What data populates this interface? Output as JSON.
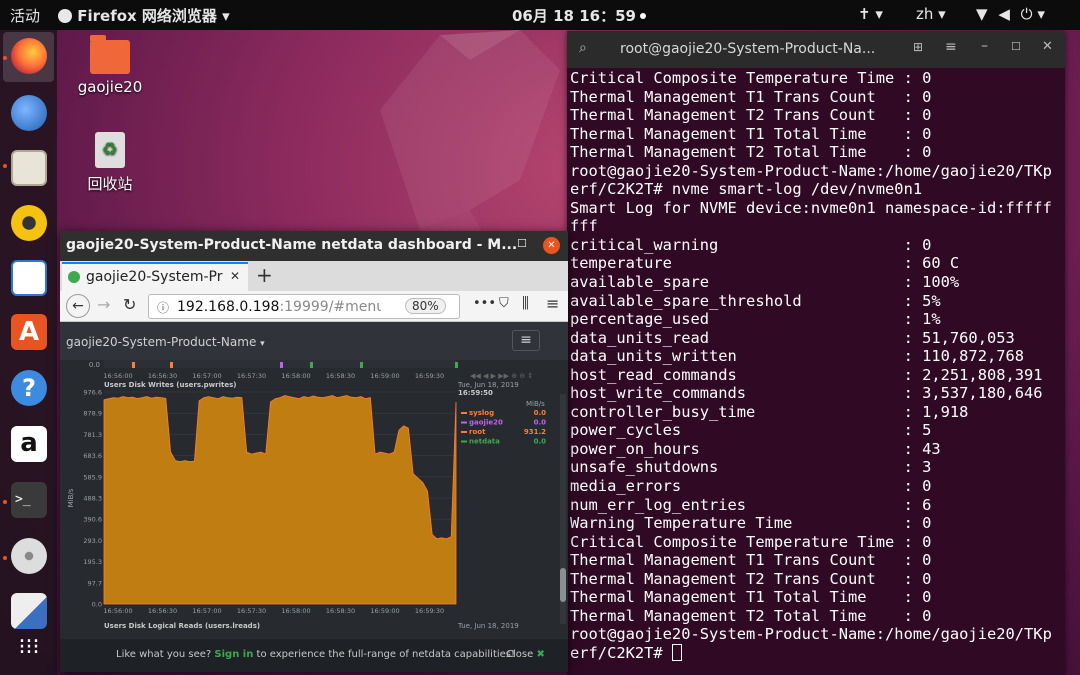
{
  "topbar": {
    "activities": "活动",
    "app": "Firefox 网络浏览器",
    "clock": "06月 18  16：59",
    "lang": "zh"
  },
  "desktop": {
    "icons": [
      {
        "label": "gaojie20"
      },
      {
        "label": "回收站"
      }
    ]
  },
  "dock": {
    "apps": [
      "firefox",
      "thunderbird",
      "files",
      "rhythmbox",
      "writer",
      "software",
      "help",
      "amazon",
      "terminal",
      "disks",
      "text-editor",
      "show-apps"
    ]
  },
  "terminal": {
    "title": "root@gaojie20-System-Product-Na...",
    "lines": [
      "Critical Composite Temperature Time : 0",
      "Thermal Management T1 Trans Count   : 0",
      "Thermal Management T2 Trans Count   : 0",
      "Thermal Management T1 Total Time    : 0",
      "Thermal Management T2 Total Time    : 0",
      "root@gaojie20-System-Product-Name:/home/gaojie20/TKp",
      "erf/C2K2T# nvme smart-log /dev/nvme0n1",
      "Smart Log for NVME device:nvme0n1 namespace-id:fffff",
      "fff",
      "critical_warning                    : 0",
      "temperature                         : 60 C",
      "available_spare                     : 100%",
      "available_spare_threshold           : 5%",
      "percentage_used                     : 1%",
      "data_units_read                     : 51,760,053",
      "data_units_written                  : 110,872,768",
      "host_read_commands                  : 2,251,808,391",
      "host_write_commands                 : 3,537,180,646",
      "controller_busy_time                : 1,918",
      "power_cycles                        : 5",
      "power_on_hours                      : 43",
      "unsafe_shutdowns                    : 3",
      "media_errors                        : 0",
      "num_err_log_entries                 : 6",
      "Warning Temperature Time            : 0",
      "Critical Composite Temperature Time : 0",
      "Thermal Management T1 Trans Count   : 0",
      "Thermal Management T2 Trans Count   : 0",
      "Thermal Management T1 Total Time    : 0",
      "Thermal Management T2 Total Time    : 0",
      "root@gaojie20-System-Product-Name:/home/gaojie20/TKp",
      "erf/C2K2T# "
    ]
  },
  "firefox": {
    "window_title": "gaojie20-System-Product-Name netdata dashboard - M...",
    "tab_title": "gaojie20-System-Pr",
    "url_host": "192.168.0.198",
    "url_rest": ":19999/#menu_",
    "zoom": "80%",
    "site_title": "gaojie20-System-Product-Name",
    "promo_text": "Like what you see?",
    "promo_link": "Sign in",
    "promo_rest": "to experience the full-range of netdata capabilities!",
    "close_label": "Close"
  },
  "chart_data": {
    "type": "area",
    "title": "Users Disk Writes (users.pwrites)",
    "ylabel": "MiB/s",
    "units": "MiB/s",
    "ylim": [
      0,
      976
    ],
    "yticks": [
      "976.6",
      "878.9",
      "781.3",
      "683.6",
      "585.9",
      "488.3",
      "390.6",
      "293.0",
      "195.3",
      "97.7",
      "0.0"
    ],
    "xticks": [
      "16:56:00",
      "16:56:30",
      "16:57:00",
      "16:57:30",
      "16:58:00",
      "16:58:30",
      "16:59:00",
      "16:59:30"
    ],
    "date": "Tue, Jun 18, 2019",
    "time": "16:59:50",
    "series": [
      {
        "name": "syslog",
        "value": "0.0",
        "color": "#fe7d37"
      },
      {
        "name": "gaojie20",
        "value": "0.0",
        "color": "#c061f0"
      },
      {
        "name": "root",
        "value": "931.2",
        "color": "#fe7d37"
      },
      {
        "name": "netdata",
        "value": "0.0",
        "color": "#3ea94d"
      }
    ],
    "root_values": [
      940,
      945,
      950,
      948,
      955,
      950,
      952,
      946,
      950,
      955,
      948,
      952,
      950,
      947,
      700,
      660,
      655,
      660,
      655,
      658,
      935,
      950,
      955,
      950,
      945,
      955,
      950,
      948,
      952,
      950,
      700,
      690,
      695,
      700,
      690,
      930,
      945,
      950,
      960,
      955,
      950,
      945,
      955,
      950,
      958,
      952,
      950,
      955,
      960,
      950,
      955,
      960,
      952,
      950,
      955,
      945,
      950,
      690,
      700,
      695,
      690,
      700,
      800,
      820,
      810,
      600,
      580,
      560,
      520,
      320,
      300,
      305,
      300,
      310,
      930
    ],
    "next_title": "Users Disk Logical Reads (users.lreads)",
    "next_date": "Tue, Jun 18, 2019"
  }
}
